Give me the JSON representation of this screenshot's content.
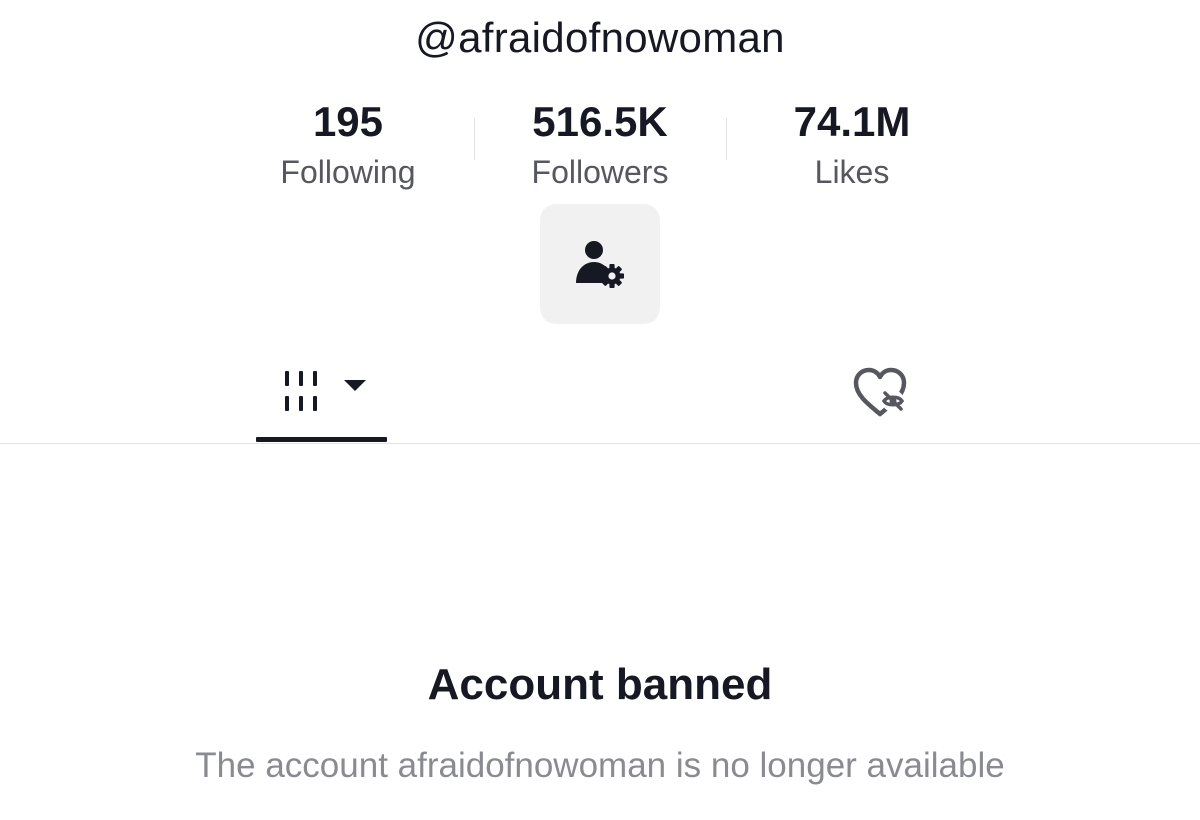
{
  "profile": {
    "username": "@afraidofnowoman"
  },
  "stats": [
    {
      "value": "195",
      "label": "Following"
    },
    {
      "value": "516.5K",
      "label": "Followers"
    },
    {
      "value": "74.1M",
      "label": "Likes"
    }
  ],
  "actions": {
    "settings_icon": "user-settings-icon"
  },
  "tabs": [
    {
      "icon": "videos-grid-icon",
      "selected": true
    },
    {
      "icon": "liked-hidden-icon",
      "selected": false
    }
  ],
  "banned": {
    "title": "Account banned",
    "description": "The account afraidofnowoman is no longer available"
  },
  "colors": {
    "text": "#161823",
    "secondary_text": "#57585f",
    "muted_text": "#8a8b91",
    "button_bg": "#f1f1f2",
    "divider": "#e3e3e4"
  }
}
